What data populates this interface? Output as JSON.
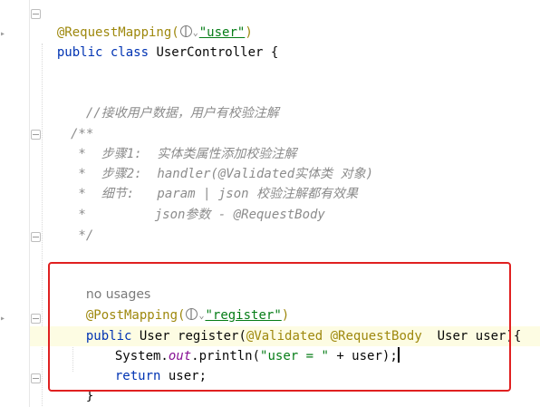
{
  "editor": {
    "language": "Java",
    "class_mapping": {
      "annotation": "@RequestMapping(",
      "value": "\"user\"",
      "close": ")"
    },
    "class_decl": {
      "kw": "public class ",
      "name": "UserController {"
    },
    "line_comment": "//接收用户数据，用户有校验注解",
    "javadoc": {
      "open": "/**",
      "line1": " *  步骤1:  实体类属性添加校验注解",
      "line2": " *  步骤2:  handler(@Validated实体类 对象)",
      "line3": " *  细节:   param | json 校验注解都有效果",
      "line4": " *         json参数 - @RequestBody",
      "close": " */"
    },
    "method": {
      "usages_hint": "no usages",
      "mapping_annotation": "@PostMapping(",
      "mapping_value": "\"register\"",
      "mapping_close": ")",
      "sig_kw": "public ",
      "sig_type": "User register(",
      "param_ann1": "@Validated ",
      "param_ann2": "@RequestBody",
      "param_rest": "  User user){",
      "body_line1_a": "System.",
      "body_line1_field": "out",
      "body_line1_b": ".println(",
      "body_line1_str": "\"user = \"",
      "body_line1_c": " + user);",
      "body_line2_kw": "return ",
      "body_line2_rest": "user;",
      "close": "}"
    }
  },
  "colors": {
    "keyword": "#0033b3",
    "annotation": "#9e880d",
    "string": "#067d17",
    "comment": "#8c8c8c",
    "highlight_box": "#e02020"
  }
}
